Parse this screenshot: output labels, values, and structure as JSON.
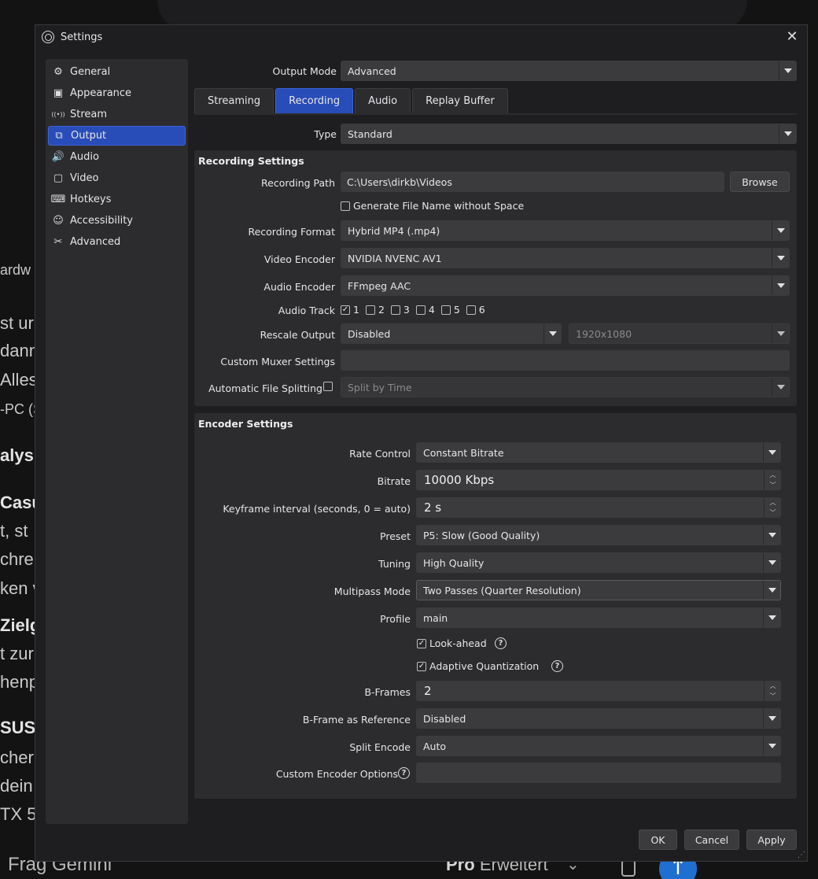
{
  "background": {
    "fragments": [
      "ardw",
      "st ur",
      "dann",
      "Alles",
      "-PC (S",
      "alys",
      "Casu",
      "t, st",
      "chre",
      "ken v",
      "Zielg",
      "t zur",
      "henp",
      "SUS I",
      "cher",
      "dein",
      "TX 5"
    ],
    "ask_placeholder": "Frag Gemini",
    "mode_bold": "Pro",
    "mode_rest": "Erweitert",
    "send_icon": "arrow-up-icon"
  },
  "window": {
    "title": "Settings",
    "close_icon": "close-icon"
  },
  "sidebar": {
    "items": [
      {
        "label": "General",
        "icon": "gear-icon"
      },
      {
        "label": "Appearance",
        "icon": "brush-icon"
      },
      {
        "label": "Stream",
        "icon": "broadcast-icon"
      },
      {
        "label": "Output",
        "icon": "output-icon",
        "active": true
      },
      {
        "label": "Audio",
        "icon": "speaker-icon"
      },
      {
        "label": "Video",
        "icon": "monitor-icon"
      },
      {
        "label": "Hotkeys",
        "icon": "keyboard-icon"
      },
      {
        "label": "Accessibility",
        "icon": "accessibility-icon"
      },
      {
        "label": "Advanced",
        "icon": "tools-icon"
      }
    ]
  },
  "output_mode": {
    "label": "Output Mode",
    "value": "Advanced"
  },
  "tabs": [
    "Streaming",
    "Recording",
    "Audio",
    "Replay Buffer"
  ],
  "active_tab": "Recording",
  "type": {
    "label": "Type",
    "value": "Standard"
  },
  "recording": {
    "title": "Recording Settings",
    "path_label": "Recording Path",
    "path_value": "C:\\Users\\dirkb\\Videos",
    "browse_label": "Browse",
    "gen_filename_label": "Generate File Name without Space",
    "gen_filename_checked": false,
    "format_label": "Recording Format",
    "format_value": "Hybrid MP4 (.mp4)",
    "video_encoder_label": "Video Encoder",
    "video_encoder_value": "NVIDIA NVENC AV1",
    "audio_encoder_label": "Audio Encoder",
    "audio_encoder_value": "FFmpeg AAC",
    "audio_track_label": "Audio Track",
    "tracks": [
      {
        "n": "1",
        "checked": true
      },
      {
        "n": "2",
        "checked": false
      },
      {
        "n": "3",
        "checked": false
      },
      {
        "n": "4",
        "checked": false
      },
      {
        "n": "5",
        "checked": false
      },
      {
        "n": "6",
        "checked": false
      }
    ],
    "rescale_label": "Rescale Output",
    "rescale_value": "Disabled",
    "rescale_res": "1920x1080",
    "muxer_label": "Custom Muxer Settings",
    "muxer_value": "",
    "split_label": "Automatic File Splitting",
    "split_value": "Split by Time"
  },
  "encoder": {
    "title": "Encoder Settings",
    "rate_control_label": "Rate Control",
    "rate_control_value": "Constant Bitrate",
    "bitrate_label": "Bitrate",
    "bitrate_value": "10000 Kbps",
    "keyframe_label": "Keyframe interval (seconds, 0 = auto)",
    "keyframe_value": "2 s",
    "preset_label": "Preset",
    "preset_value": "P5: Slow (Good Quality)",
    "tuning_label": "Tuning",
    "tuning_value": "High Quality",
    "multipass_label": "Multipass Mode",
    "multipass_value": "Two Passes (Quarter Resolution)",
    "profile_label": "Profile",
    "profile_value": "main",
    "lookahead_label": "Look-ahead",
    "aq_label": "Adaptive Quantization",
    "bframes_label": "B-Frames",
    "bframes_value": "2",
    "bframe_ref_label": "B-Frame as Reference",
    "bframe_ref_value": "Disabled",
    "split_encode_label": "Split Encode",
    "split_encode_value": "Auto",
    "custom_opts_label": "Custom Encoder Options",
    "custom_opts_value": ""
  },
  "footer": {
    "ok": "OK",
    "cancel": "Cancel",
    "apply": "Apply"
  }
}
